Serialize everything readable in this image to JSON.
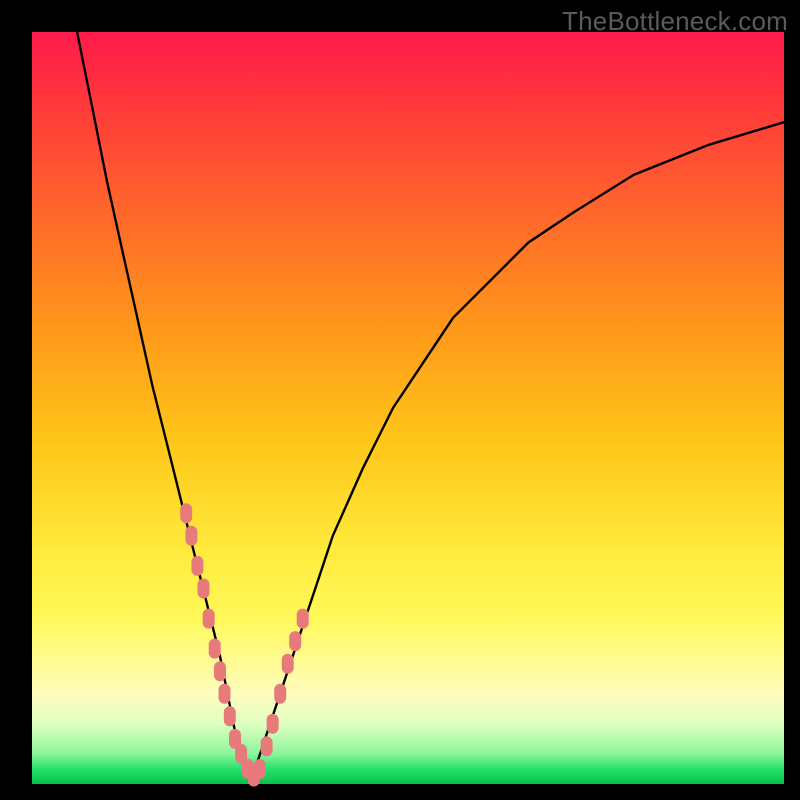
{
  "watermark": "TheBottleneck.com",
  "colors": {
    "frame": "#000000",
    "curve": "#000000",
    "marker": "#e77b7b",
    "gradient_top": "#ff1a4b",
    "gradient_mid": "#ffe83a",
    "gradient_bottom": "#06c24a"
  },
  "chart_data": {
    "type": "line",
    "title": "",
    "xlabel": "",
    "ylabel": "",
    "xlim": [
      0,
      100
    ],
    "ylim": [
      0,
      100
    ],
    "grid": false,
    "legend": false,
    "series": [
      {
        "name": "bottleneck-curve",
        "x": [
          6,
          8,
          10,
          12,
          14,
          16,
          18,
          20,
          22,
          24,
          25,
          26,
          27,
          28,
          29,
          30,
          32,
          34,
          36,
          38,
          40,
          44,
          48,
          52,
          56,
          60,
          66,
          72,
          80,
          90,
          100
        ],
        "values": [
          100,
          90,
          80,
          71,
          62,
          53,
          45,
          37,
          29,
          21,
          17,
          12,
          7,
          3,
          1,
          3,
          9,
          15,
          21,
          27,
          33,
          42,
          50,
          56,
          62,
          66,
          72,
          76,
          81,
          85,
          88
        ]
      }
    ],
    "markers": {
      "name": "highlight-points",
      "x": [
        20.5,
        21.2,
        22.0,
        22.8,
        23.5,
        24.3,
        25.0,
        25.6,
        26.3,
        27.0,
        27.8,
        28.7,
        29.5,
        30.3,
        31.2,
        32.0,
        33.0,
        34.0,
        35.0,
        36.0
      ],
      "values": [
        36,
        33,
        29,
        26,
        22,
        18,
        15,
        12,
        9,
        6,
        4,
        2,
        1,
        2,
        5,
        8,
        12,
        16,
        19,
        22
      ]
    }
  }
}
